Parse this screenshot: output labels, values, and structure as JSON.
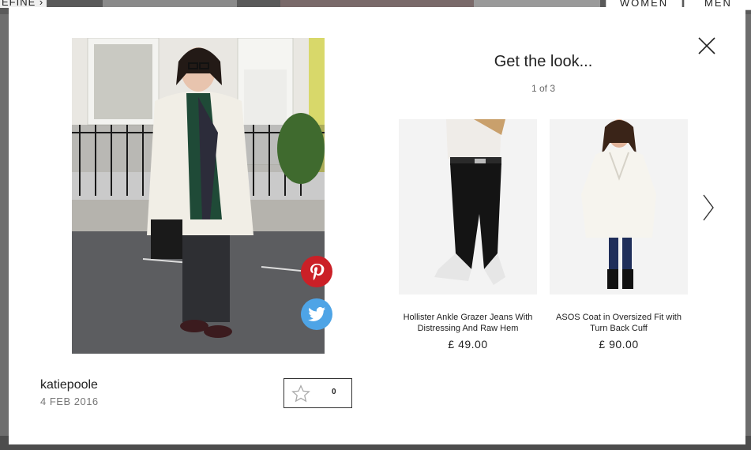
{
  "background": {
    "refine_label": "EFINE",
    "nav": [
      "WOMEN",
      "MEN"
    ]
  },
  "modal": {
    "title": "Get the look...",
    "pager": "1 of 3",
    "user": {
      "name": "katiepoole",
      "date": "4 FEB 2016"
    },
    "likes": {
      "count": "0"
    },
    "share": {
      "pinterest_icon": "pinterest-icon",
      "twitter_icon": "twitter-icon"
    },
    "products": [
      {
        "name": "Hollister Ankle Grazer Jeans With Distressing And Raw Hem",
        "price": "£ 49.00"
      },
      {
        "name": "ASOS Coat in Oversized Fit with Turn Back Cuff",
        "price": "£ 90.00"
      }
    ],
    "colors": {
      "pinterest": "#cb2027",
      "twitter": "#4ea4e6"
    }
  }
}
